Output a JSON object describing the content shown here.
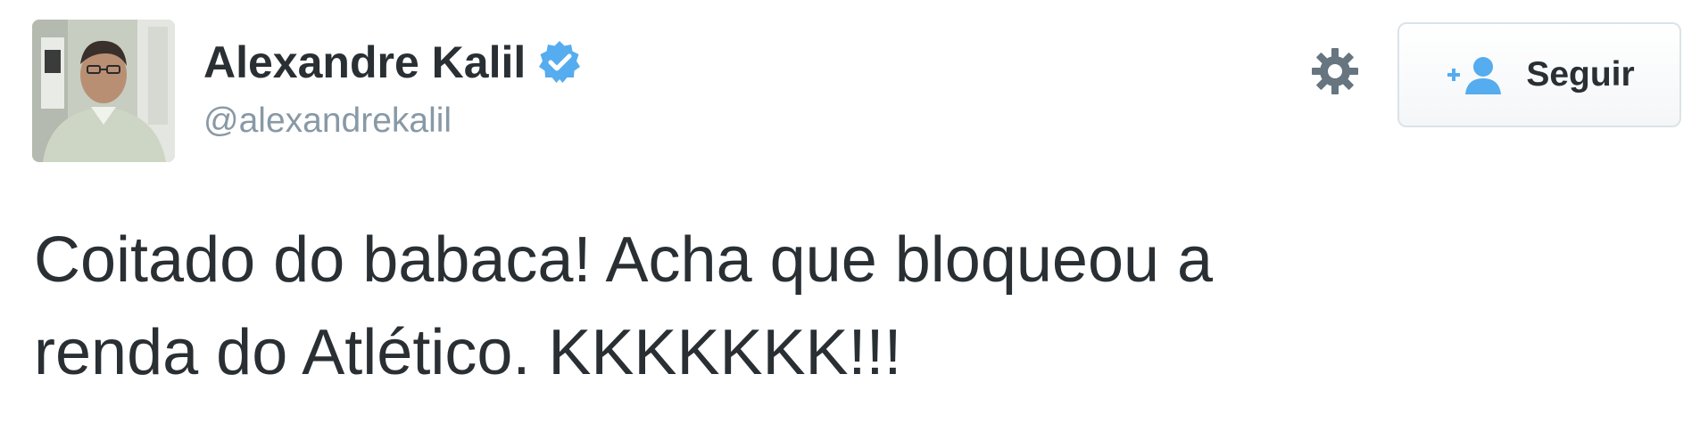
{
  "author": {
    "display_name": "Alexandre Kalil",
    "handle": "@alexandrekalil",
    "verified_icon": "verified-badge-icon",
    "avatar_icon": "profile-photo"
  },
  "actions": {
    "settings_icon": "gear-icon",
    "follow_label": "Seguir",
    "follow_icon": "add-user-icon"
  },
  "tweet": {
    "lines": [
      "Coitado do babaca! Acha que bloqueou a",
      "renda do Atlético. KKKKKKK!!!"
    ]
  },
  "colors": {
    "accent_blue": "#55acee",
    "handle_gray": "#8899a6",
    "text": "#292f33",
    "icon_gray": "#66757f"
  }
}
